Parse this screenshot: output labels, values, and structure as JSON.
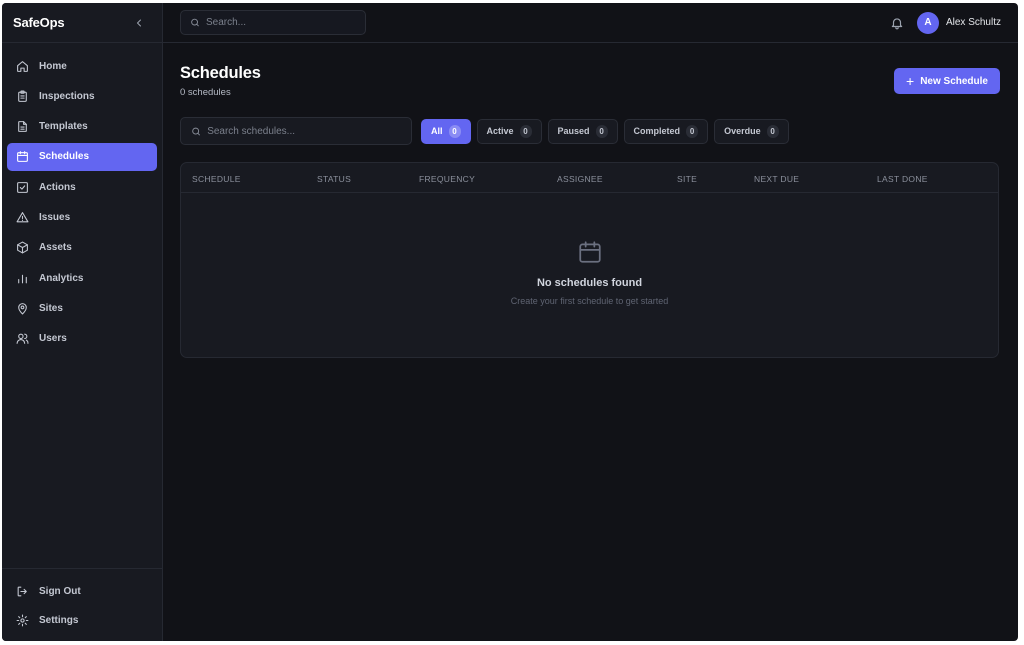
{
  "app": {
    "brand": "SafeOps"
  },
  "sidebar": {
    "items": [
      {
        "label": "Home",
        "icon": "home-icon",
        "active": false
      },
      {
        "label": "Inspections",
        "icon": "clipboard-icon",
        "active": false
      },
      {
        "label": "Templates",
        "icon": "document-icon",
        "active": false
      },
      {
        "label": "Schedules",
        "icon": "calendar-icon",
        "active": true
      },
      {
        "label": "Actions",
        "icon": "checkbox-icon",
        "active": false
      },
      {
        "label": "Issues",
        "icon": "warning-icon",
        "active": false
      },
      {
        "label": "Assets",
        "icon": "box-icon",
        "active": false
      },
      {
        "label": "Analytics",
        "icon": "bar-chart-icon",
        "active": false
      },
      {
        "label": "Sites",
        "icon": "map-pin-icon",
        "active": false
      },
      {
        "label": "Users",
        "icon": "users-icon",
        "active": false
      }
    ],
    "bottom": [
      {
        "label": "Sign Out",
        "icon": "sign-out-icon"
      },
      {
        "label": "Settings",
        "icon": "gear-icon"
      }
    ]
  },
  "topbar": {
    "search_placeholder": "Search...",
    "avatar_initial": "A",
    "user_name": "Alex Schultz"
  },
  "page": {
    "title": "Schedules",
    "subtitle": "0 schedules",
    "new_button": "New Schedule"
  },
  "filters": {
    "search_placeholder": "Search schedules...",
    "chips": [
      {
        "label": "All",
        "count": "0",
        "active": true
      },
      {
        "label": "Active",
        "count": "0",
        "active": false
      },
      {
        "label": "Paused",
        "count": "0",
        "active": false
      },
      {
        "label": "Completed",
        "count": "0",
        "active": false
      },
      {
        "label": "Overdue",
        "count": "0",
        "active": false
      }
    ]
  },
  "table": {
    "columns": [
      "SCHEDULE",
      "STATUS",
      "FREQUENCY",
      "ASSIGNEE",
      "SITE",
      "NEXT DUE",
      "LAST DONE"
    ],
    "empty_title": "No schedules found",
    "empty_subtitle": "Create your first schedule to get started"
  },
  "colors": {
    "accent": "#6366f1",
    "background": "#111217",
    "sidebar": "#181a21"
  }
}
